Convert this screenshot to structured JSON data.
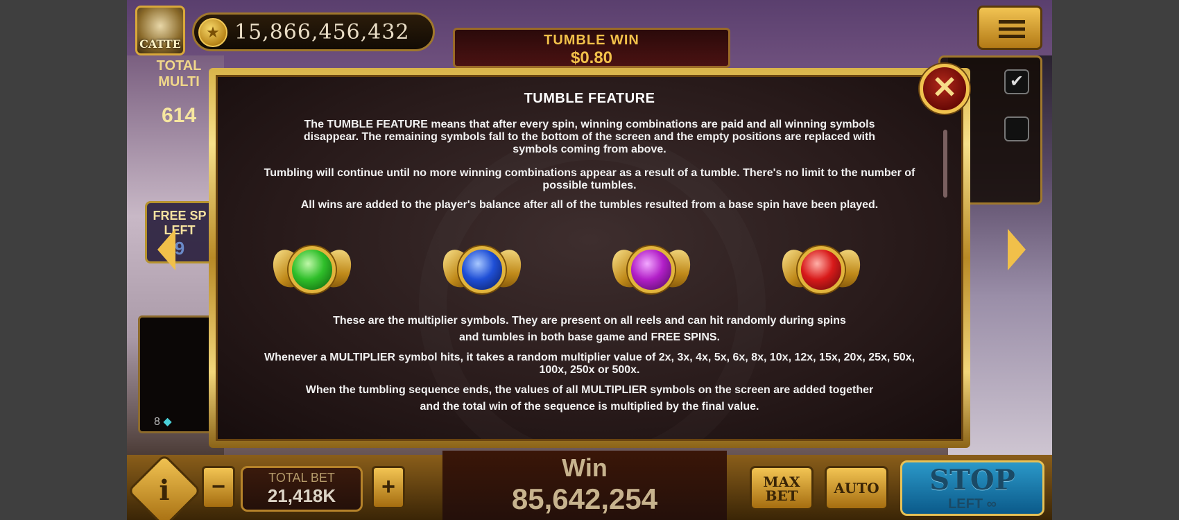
{
  "hud": {
    "logo_text": "CATTE",
    "balance": "15,866,456,432",
    "tumble_win_label": "TUMBLE WIN",
    "tumble_win_value": "$0.80",
    "total_multiplier_label": "TOTAL MULTI",
    "total_multiplier_value": "614",
    "free_spins_label": "FREE SP LEFT",
    "free_spins_value": "9",
    "gem_count": "8",
    "total_bet_label": "TOTAL BET",
    "total_bet_value": "21,418K",
    "win_label": "Win",
    "win_value": "85,642,254",
    "max_bet_label_1": "MAX",
    "max_bet_label_2": "BET",
    "auto_label": "AUTO",
    "stop_label": "STOP",
    "stop_sub_label": "LEFT ∞",
    "minus_label": "−",
    "plus_label": "+",
    "info_label": "i"
  },
  "panel": {
    "title": "TUMBLE FEATURE",
    "para1": "The TUMBLE FEATURE means that after every spin, winning combinations are paid and all winning symbols disappear. The remaining symbols fall to the bottom of the screen and the empty positions are replaced with symbols coming from above.",
    "para2": "Tumbling will continue until no more winning combinations appear as a result of a tumble. There's no limit to the number of possible tumbles.",
    "para3": "All wins are added to the player's balance after all of the tumbles resulted from a base spin have been played.",
    "para4": "These are the multiplier symbols. They are present on all reels and can hit randomly during spins and tumbles in both base game and FREE SPINS.",
    "para5": "Whenever a MULTIPLIER symbol hits, it takes a random multiplier value of 2x, 3x, 4x, 5x, 6x, 8x, 10x, 12x, 15x, 20x, 25x, 50x, 100x, 250x or 500x.",
    "para6": "When the tumbling sequence ends, the values of all MULTIPLIER symbols on the screen are added together and the total win of the sequence is multiplied by the final value.",
    "orbs": [
      {
        "name": "green-multiplier-orb",
        "color": "#2fbf2a"
      },
      {
        "name": "blue-multiplier-orb",
        "color": "#1f4fd6"
      },
      {
        "name": "purple-multiplier-orb",
        "color": "#b21fc8"
      },
      {
        "name": "red-multiplier-orb",
        "color": "#d81a1a"
      }
    ],
    "close_icon": "close-x-icon"
  },
  "colors": {
    "frame_gold": "#e0b84a",
    "text_white": "#f2f2f2",
    "win_text": "#c7b38e",
    "stop_blue": "#2b98c8"
  }
}
